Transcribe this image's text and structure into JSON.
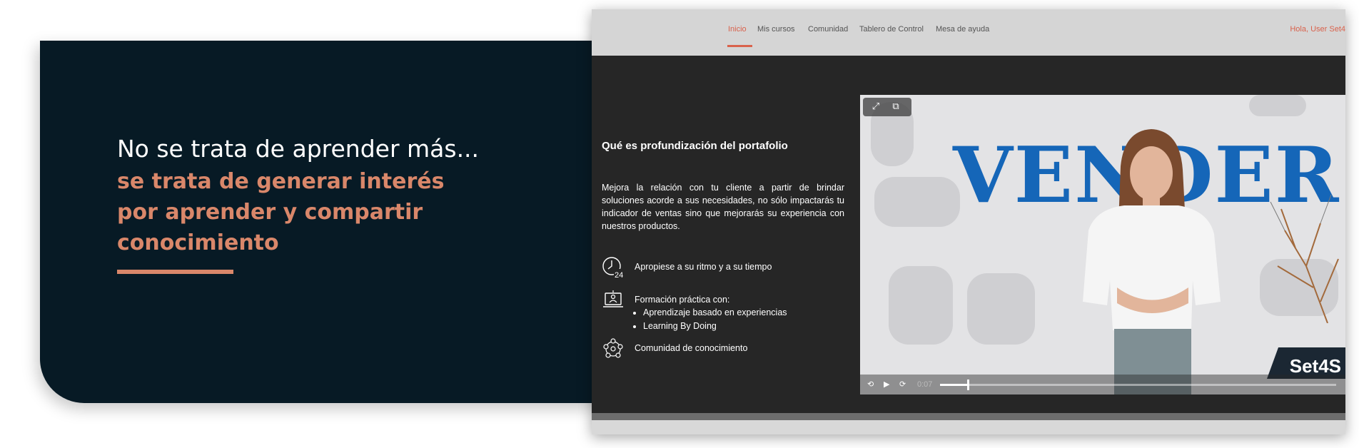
{
  "banner": {
    "line1": "No se trata de aprender más...",
    "highlight_lines": [
      "se trata de generar interés",
      "por aprender y compartir",
      "conocimiento"
    ],
    "bg_color": "#071a25",
    "accent_color": "#d9876a"
  },
  "navbar": {
    "items": [
      {
        "label": "Inicio",
        "active": true
      },
      {
        "label": "Mis cursos",
        "active": false
      },
      {
        "label": "Comunidad",
        "active": false
      },
      {
        "label": "Tablero de Control",
        "active": false
      },
      {
        "label": "Mesa de ayuda",
        "active": false
      }
    ],
    "greeting": "Hola, User Set4",
    "accent_color": "#d9624c"
  },
  "course": {
    "title": "Qué es profundización del portafolio",
    "description": "Mejora la relación con tu cliente a partir de brindar soluciones acorde a sus necesidades, no sólo impactarás tu indicador de ventas sino que mejorarás su experiencia con nuestros productos.",
    "features": [
      {
        "icon": "clock-24-icon",
        "text": "Apropiese a su ritmo y a su tiempo",
        "bullets": []
      },
      {
        "icon": "laptop-learning-icon",
        "text": "Formación práctica con:",
        "bullets": [
          "Aprendizaje basado en experiencias",
          "Learning By Doing"
        ]
      },
      {
        "icon": "community-network-icon",
        "text": "Comunidad de conocimiento",
        "bullets": []
      }
    ]
  },
  "video": {
    "overlay_word": "VENDER",
    "logo_text": "Set4S",
    "time": "0:07",
    "progress_fraction": 0.07,
    "overlay_color": "#1566b8",
    "controls": [
      "fullscreen-icon",
      "picture-in-picture-icon",
      "rewind-icon",
      "play-icon",
      "forward-icon"
    ]
  }
}
